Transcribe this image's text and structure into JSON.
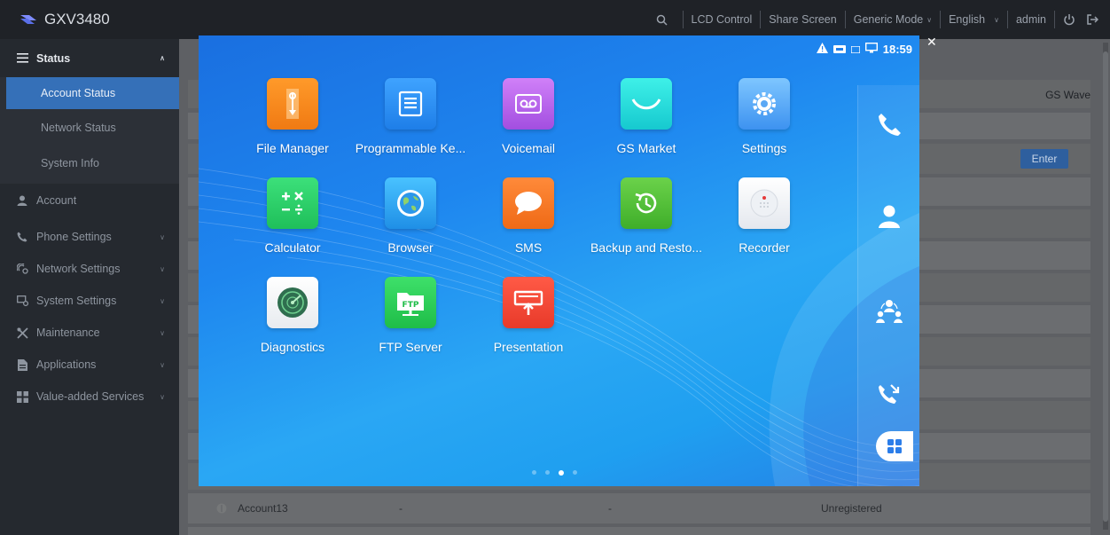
{
  "header": {
    "brand": "GXV3480",
    "menu": [
      "LCD Control",
      "Share Screen",
      "Generic Mode",
      "English",
      "admin"
    ],
    "icons": [
      "search-icon",
      "power-icon",
      "logout-icon"
    ]
  },
  "sidebar": {
    "status_label": "Status",
    "status_children": [
      "Account Status",
      "Network Status",
      "System Info"
    ],
    "items": [
      {
        "label": "Account",
        "icon": "person-icon",
        "has_chevron": false
      },
      {
        "label": "Phone Settings",
        "icon": "phone-icon",
        "has_chevron": true
      },
      {
        "label": "Network Settings",
        "icon": "network-settings-icon",
        "has_chevron": true
      },
      {
        "label": "System Settings",
        "icon": "system-settings-icon",
        "has_chevron": true
      },
      {
        "label": "Maintenance",
        "icon": "tools-icon",
        "has_chevron": true
      },
      {
        "label": "Applications",
        "icon": "applications-icon",
        "has_chevron": true
      },
      {
        "label": "Value-added Services",
        "icon": "services-icon",
        "has_chevron": true
      }
    ]
  },
  "main": {
    "gs_wave": "GS Wave",
    "enter_label": "Enter",
    "account_row": {
      "name": "Account13",
      "col2": "-",
      "col3": "-",
      "status": "Unregistered"
    }
  },
  "screen": {
    "time": "18:59",
    "apps": [
      {
        "name": "File Manager",
        "icon": "file-manager-icon"
      },
      {
        "name": "Programmable Ke...",
        "icon": "programmable-keys-icon"
      },
      {
        "name": "Voicemail",
        "icon": "voicemail-icon"
      },
      {
        "name": "GS Market",
        "icon": "gs-market-icon"
      },
      {
        "name": "Settings",
        "icon": "settings-gear-icon"
      },
      {
        "name": "Calculator",
        "icon": "calculator-icon"
      },
      {
        "name": "Browser",
        "icon": "browser-globe-icon"
      },
      {
        "name": "SMS",
        "icon": "sms-bubble-icon"
      },
      {
        "name": "Backup and Resto...",
        "icon": "backup-restore-icon"
      },
      {
        "name": "Recorder",
        "icon": "recorder-icon"
      },
      {
        "name": "Diagnostics",
        "icon": "diagnostics-icon"
      },
      {
        "name": "FTP Server",
        "icon": "ftp-server-icon"
      },
      {
        "name": "Presentation",
        "icon": "presentation-icon"
      }
    ],
    "ftp_badge": "FTP",
    "dock": [
      "phone-call-icon",
      "contacts-icon",
      "conference-icon",
      "call-history-icon"
    ],
    "page_dots": 4,
    "active_page": 3
  }
}
